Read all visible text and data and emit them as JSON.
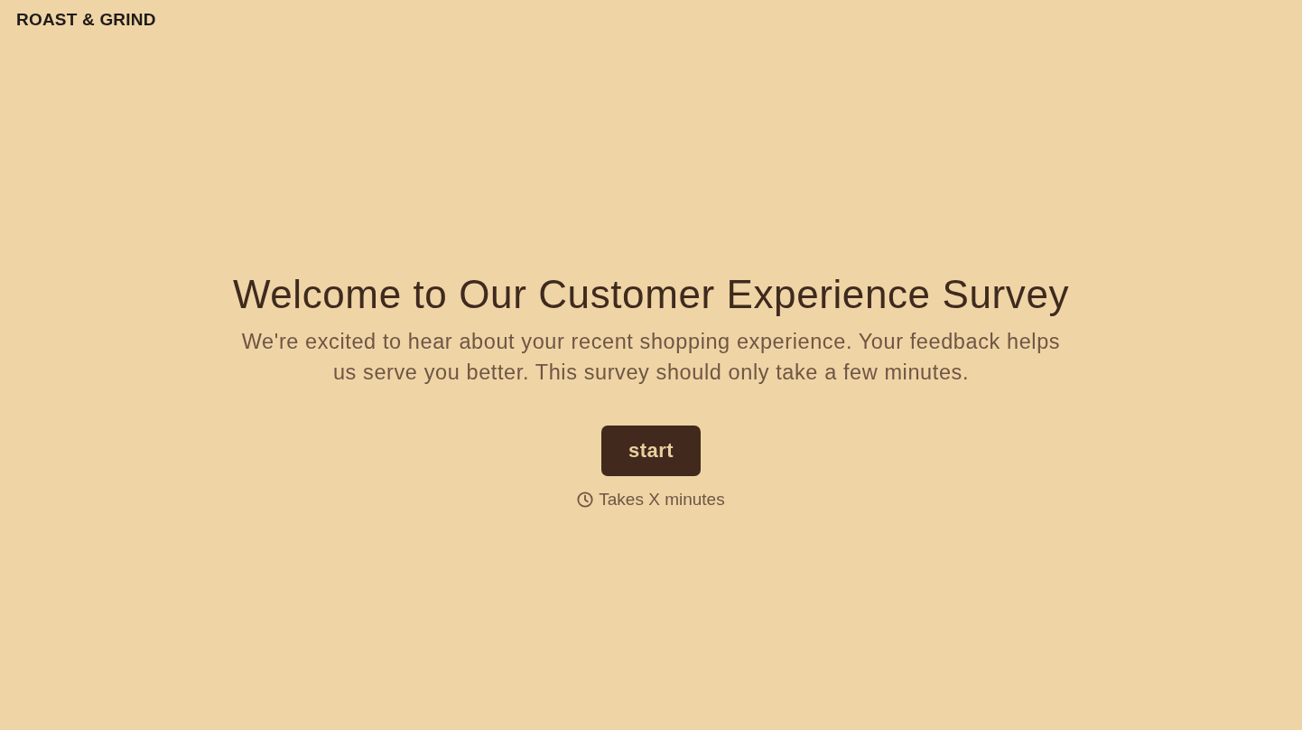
{
  "header": {
    "logo": "ROAST & GRIND"
  },
  "intro": {
    "title": "Welcome to Our Customer Experience Survey",
    "description": "We're excited to hear about your recent shopping experience. Your feedback helps us serve you better. This survey should only take a few minutes."
  },
  "start_button": {
    "label": "start"
  },
  "duration": {
    "text": "Takes X minutes"
  }
}
